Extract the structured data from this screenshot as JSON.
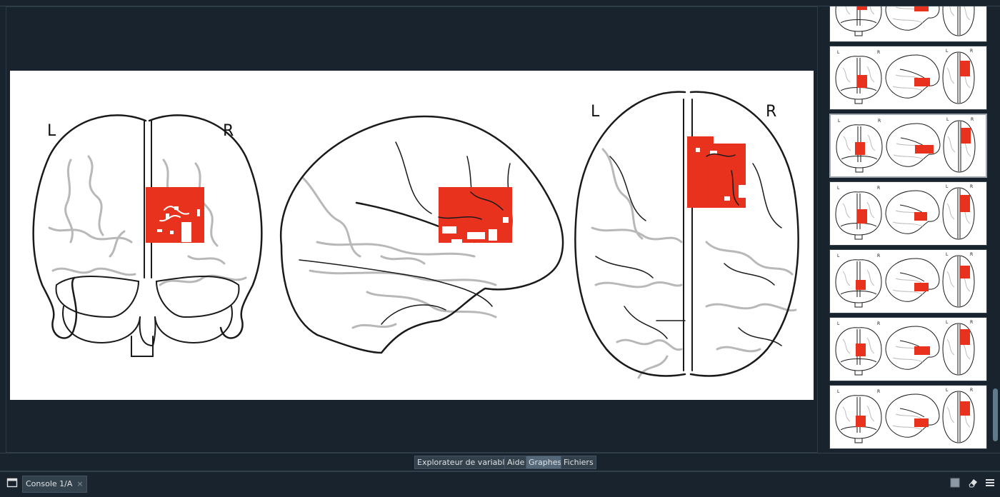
{
  "pane_tabs": [
    {
      "label": "Explorateur de variables",
      "active": false
    },
    {
      "label": "Aide",
      "active": false
    },
    {
      "label": "Graphes",
      "active": true
    },
    {
      "label": "Fichiers",
      "active": false
    }
  ],
  "console": {
    "tab_label": "Console 1/A",
    "close_glyph": "×"
  },
  "figure": {
    "coronal": {
      "left_label": "L",
      "right_label": "R"
    },
    "axial": {
      "left_label": "L",
      "right_label": "R"
    }
  },
  "thumbnails": {
    "count": 7,
    "selected_index": 2,
    "left_label": "L",
    "right_label": "R"
  },
  "icons": {
    "console_pane": "window-icon",
    "stop": "stop-square-icon",
    "clear": "eraser-icon",
    "options": "hamburger-menu-icon"
  },
  "colors": {
    "background": "#19232d",
    "activation": "#e8321e",
    "outline": "#1a1a1a",
    "sulci": "#b8b8b8"
  }
}
